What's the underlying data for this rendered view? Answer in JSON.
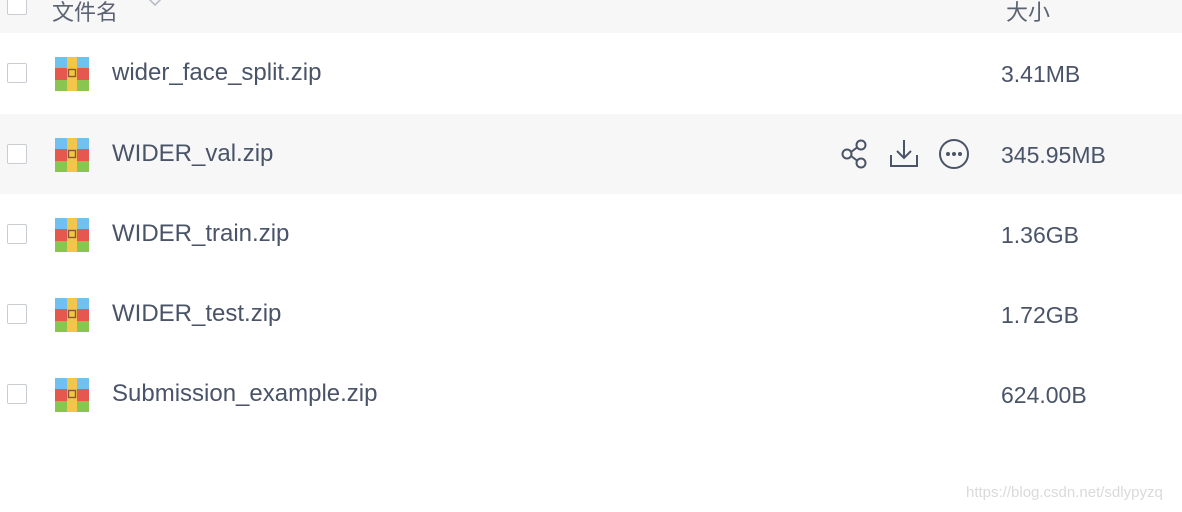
{
  "header": {
    "name_label": "文件名",
    "size_label": "大小"
  },
  "files": [
    {
      "name": "wider_face_split.zip",
      "size": "3.41MB"
    },
    {
      "name": "WIDER_val.zip",
      "size": "345.95MB"
    },
    {
      "name": "WIDER_train.zip",
      "size": "1.36GB"
    },
    {
      "name": "WIDER_test.zip",
      "size": "1.72GB"
    },
    {
      "name": "Submission_example.zip",
      "size": "624.00B"
    }
  ],
  "hovered_row_actions": [
    "share-icon",
    "download-icon",
    "more-icon"
  ],
  "icons": {
    "file_type": "zip-archive-icon"
  },
  "colors": {
    "zip_blue": "#6ec3ee",
    "zip_red": "#e6584f",
    "zip_green": "#8ac54f",
    "zip_tag": "#f3c64a"
  },
  "watermark": "https://blog.csdn.net/sdlypyzq"
}
